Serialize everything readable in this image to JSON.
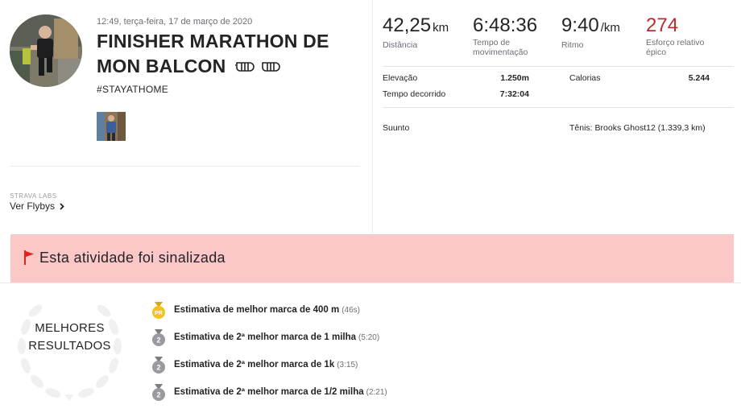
{
  "activity": {
    "date": "12:49, terça-feira, 17 de março de 2020",
    "title": "FINISHER MARATHON DE MON BALCON",
    "description": "#STAYATHOME",
    "labs_label": "STRAVA LABS",
    "flybys_link": "Ver Flybys"
  },
  "stats": {
    "distance": {
      "value": "42,25",
      "unit": "km",
      "label": "Distância"
    },
    "moving_time": {
      "value": "6:48:36",
      "label": "Tempo de movimentação"
    },
    "pace": {
      "value": "9:40",
      "unit": "/km",
      "label": "Ritmo"
    },
    "relative_effort": {
      "value": "274",
      "label": "Esforço relativo épico"
    }
  },
  "details": {
    "elevation": {
      "label": "Elevação",
      "value": "1.250m"
    },
    "calories": {
      "label": "Calorias",
      "value": "5.244"
    },
    "elapsed": {
      "label": "Tempo decorrido",
      "value": "7:32:04"
    },
    "device": "Suunto",
    "shoes": "Tênis: Brooks Ghost12 (1.339,3 km)"
  },
  "flag_banner": {
    "text": "Esta atividade foi sinalizada",
    "icon": "flag-icon",
    "color": "#fcc7c7"
  },
  "best_efforts": {
    "heading_line1": "MELHORES",
    "heading_line2": "RESULTADOS",
    "items": [
      {
        "medal": "pr-medal-icon",
        "text": "Estimativa de melhor marca de 400 m",
        "time": "(46s)"
      },
      {
        "medal": "second-medal-icon",
        "medal_label": "2",
        "text": "Estimativa de 2ª melhor marca de 1 milha",
        "time": "(5:20)"
      },
      {
        "medal": "second-medal-icon",
        "medal_label": "2",
        "text": "Estimativa de 2ª melhor marca de 1k",
        "time": "(3:15)"
      },
      {
        "medal": "second-medal-icon",
        "medal_label": "2",
        "text": "Estimativa de 2ª melhor marca de 1/2 milha",
        "time": "(2:21)"
      }
    ],
    "pr_label": "PR"
  },
  "colors": {
    "epic": "#c0282c",
    "flag_red": "#e0231f",
    "gold": "#f5c21b",
    "silver": "#9a9aa0"
  }
}
